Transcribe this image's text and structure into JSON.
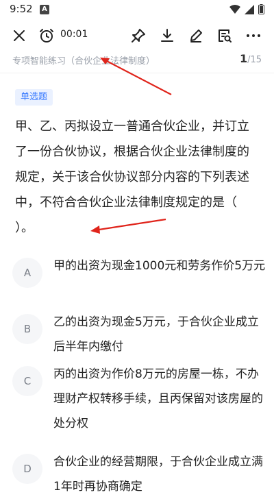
{
  "status": {
    "time": "9:52",
    "a_badge": "A"
  },
  "toolbar": {
    "timer": "00:01"
  },
  "header": {
    "breadcrumb": "专项智能练习（合伙企业法律制度）",
    "current_page": "1",
    "total_pages": "/15"
  },
  "question": {
    "type": "单选题",
    "text": "甲、乙、丙拟设立一普通合伙企业，并订立了一份合伙协议，根据合伙企业法律制度的规定，关于该合伙协议部分内容的下列表述中，不符合合伙企业法律制度规定的是（   ）。",
    "options": [
      {
        "letter": "A",
        "text": "甲的出资为现金1000元和劳务作价5万元"
      },
      {
        "letter": "B",
        "text": "乙的出资为现金5万元，于合伙企业成立后半年内缴付"
      },
      {
        "letter": "C",
        "text": "丙的出资为作价8万元的房屋一栋，不办理财产权转移手续，且丙保留对该房屋的处分权"
      },
      {
        "letter": "D",
        "text": "合伙企业的经营期限，于合伙企业成立满1年时再协商确定"
      }
    ]
  },
  "colors": {
    "accent": "#3b7cff",
    "arrow": "#e0241b"
  }
}
